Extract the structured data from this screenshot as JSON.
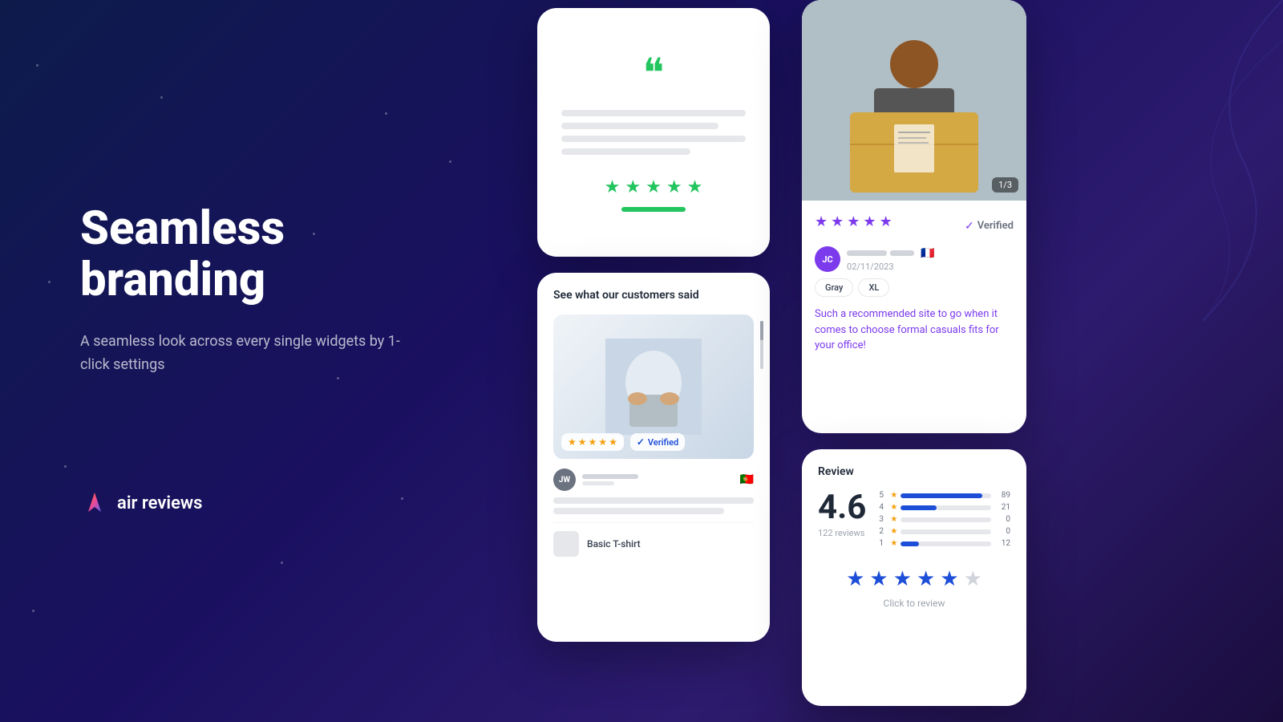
{
  "hero": {
    "title": "Seamless branding",
    "subtitle": "A seamless look across every single widgets by 1-click settings"
  },
  "logo": {
    "text": "air reviews"
  },
  "widget1": {
    "stars": [
      "★",
      "★",
      "★",
      "★",
      "★"
    ]
  },
  "widget2": {
    "title": "See what our customers said",
    "verified_label": "Verified",
    "reviewer_initials": "JW",
    "flag": "🇵🇹",
    "product_name": "Basic T-shirt",
    "star_rating": 4.5
  },
  "widget3": {
    "counter": "1/3",
    "verified_label": "Verified",
    "reviewer_initials": "JC",
    "date": "02/11/2023",
    "flag": "🇫🇷",
    "tag1": "Gray",
    "tag2": "XL",
    "review_text": "Such a recommended site to go when it comes to choose formal casuals fits for your office!"
  },
  "widget4": {
    "label": "Review",
    "score": "4.6",
    "total_reviews": "122 reviews",
    "rating_5": {
      "count": 89,
      "pct": 90
    },
    "rating_4": {
      "count": 21,
      "pct": 40
    },
    "rating_3": {
      "count": 0,
      "pct": 0
    },
    "rating_2": {
      "count": 0,
      "pct": 0
    },
    "rating_1": {
      "count": 12,
      "pct": 20
    },
    "click_to_review": "Click to review"
  }
}
